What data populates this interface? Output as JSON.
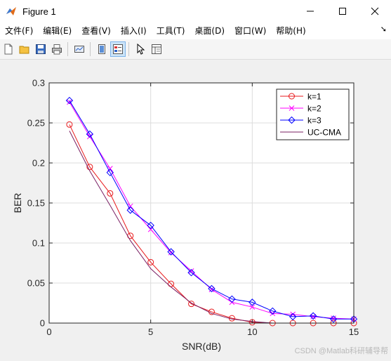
{
  "window": {
    "title": "Figure 1"
  },
  "menu": [
    "文件(F)",
    "编辑(E)",
    "查看(V)",
    "插入(I)",
    "工具(T)",
    "桌面(D)",
    "窗口(W)",
    "帮助(H)"
  ],
  "toolbar": {
    "icons": [
      "new-figure-icon",
      "open-file-icon",
      "save-icon",
      "print-icon",
      "link-plot-icon",
      "hide-plot-tools-icon",
      "show-plot-tools-icon",
      "edit-plot-icon",
      "property-inspector-icon"
    ]
  },
  "colors": {
    "k1": "#e8191c",
    "k2": "#ff00ff",
    "k3": "#0000ff",
    "uc": "#7a1f63"
  },
  "watermark": "CSDN @Matlab科研辅导帮",
  "chart_data": {
    "type": "line",
    "xlabel": "SNR(dB)",
    "ylabel": "BER",
    "xlim": [
      0,
      15
    ],
    "ylim": [
      0,
      0.3
    ],
    "xticks": [
      0,
      5,
      10,
      15
    ],
    "xtick_labels": [
      "0",
      "5",
      "10",
      "15"
    ],
    "yticks": [
      0,
      0.05,
      0.1,
      0.15,
      0.2,
      0.25,
      0.3
    ],
    "ytick_labels": [
      "0",
      "0.05",
      "0.1",
      "0.15",
      "0.2",
      "0.25",
      "0.3"
    ],
    "grid": true,
    "legend_position": "top-right",
    "x": [
      1,
      2,
      3,
      4,
      5,
      6,
      7,
      8,
      9,
      10,
      11,
      12,
      13,
      14,
      15
    ],
    "series": [
      {
        "name": "k=1",
        "marker": "circle",
        "color": "#e8191c",
        "values": [
          0.248,
          0.195,
          0.162,
          0.109,
          0.076,
          0.049,
          0.024,
          0.014,
          0.006,
          0.001,
          0.0,
          0.0,
          0.0,
          0.0,
          0.0
        ]
      },
      {
        "name": "k=2",
        "marker": "x",
        "color": "#ff00ff",
        "values": [
          0.276,
          0.233,
          0.193,
          0.146,
          0.117,
          0.088,
          0.065,
          0.042,
          0.026,
          0.02,
          0.012,
          0.011,
          0.008,
          0.006,
          0.005
        ]
      },
      {
        "name": "k=3",
        "marker": "diamond",
        "color": "#0000ff",
        "values": [
          0.278,
          0.236,
          0.188,
          0.141,
          0.122,
          0.089,
          0.063,
          0.043,
          0.03,
          0.026,
          0.015,
          0.008,
          0.009,
          0.005,
          0.005
        ]
      },
      {
        "name": "UC-CMA",
        "marker": "none",
        "color": "#7a1f63",
        "values": [
          0.24,
          0.19,
          0.147,
          0.103,
          0.068,
          0.045,
          0.025,
          0.012,
          0.005,
          0.002,
          0.0,
          0.0,
          0.0,
          0.0,
          0.0
        ]
      }
    ]
  }
}
